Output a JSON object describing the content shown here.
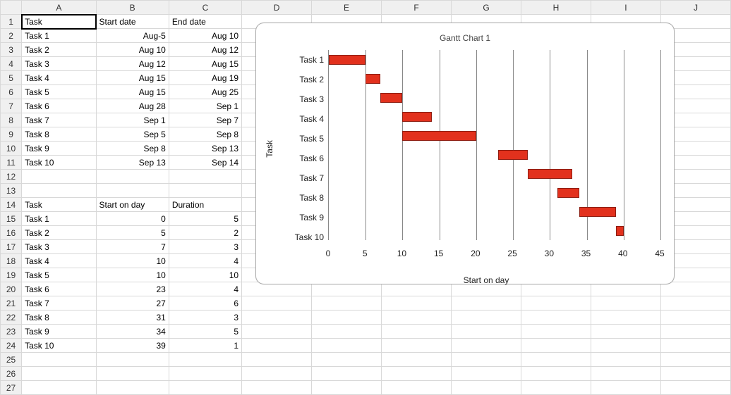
{
  "columns": [
    "A",
    "B",
    "C",
    "D",
    "E",
    "F",
    "G",
    "H",
    "I",
    "J"
  ],
  "row_count": 27,
  "selected_cell": "A1",
  "table1": {
    "row": 1,
    "headers": {
      "A": "Task",
      "B": "Start date",
      "C": "End date"
    },
    "rows": [
      {
        "A": "Task 1",
        "B": "Aug-5",
        "C": "Aug 10"
      },
      {
        "A": "Task 2",
        "B": "Aug 10",
        "C": "Aug 12"
      },
      {
        "A": "Task 3",
        "B": "Aug 12",
        "C": "Aug 15"
      },
      {
        "A": "Task 4",
        "B": "Aug 15",
        "C": "Aug 19"
      },
      {
        "A": "Task 5",
        "B": "Aug 15",
        "C": "Aug 25"
      },
      {
        "A": "Task 6",
        "B": "Aug 28",
        "C": "Sep 1"
      },
      {
        "A": "Task 7",
        "B": "Sep 1",
        "C": "Sep 7"
      },
      {
        "A": "Task 8",
        "B": "Sep 5",
        "C": "Sep 8"
      },
      {
        "A": "Task 9",
        "B": "Sep 8",
        "C": "Sep 13"
      },
      {
        "A": "Task 10",
        "B": "Sep 13",
        "C": "Sep 14"
      }
    ]
  },
  "table2": {
    "row": 14,
    "headers": {
      "A": "Task",
      "B": "Start on day",
      "C": "Duration"
    },
    "rows": [
      {
        "A": "Task 1",
        "B": "0",
        "C": "5"
      },
      {
        "A": "Task 2",
        "B": "5",
        "C": "2"
      },
      {
        "A": "Task 3",
        "B": "7",
        "C": "3"
      },
      {
        "A": "Task 4",
        "B": "10",
        "C": "4"
      },
      {
        "A": "Task 5",
        "B": "10",
        "C": "10"
      },
      {
        "A": "Task 6",
        "B": "23",
        "C": "4"
      },
      {
        "A": "Task 7",
        "B": "27",
        "C": "6"
      },
      {
        "A": "Task 8",
        "B": "31",
        "C": "3"
      },
      {
        "A": "Task 9",
        "B": "34",
        "C": "5"
      },
      {
        "A": "Task 10",
        "B": "39",
        "C": "1"
      }
    ]
  },
  "chart_data": {
    "type": "bar",
    "orientation": "horizontal",
    "title": "Gantt Chart 1",
    "xlabel": "Start on day",
    "ylabel": "Task",
    "xlim": [
      0,
      45
    ],
    "xticks": [
      0,
      5,
      10,
      15,
      20,
      25,
      30,
      35,
      40,
      45
    ],
    "categories": [
      "Task 1",
      "Task 2",
      "Task 3",
      "Task 4",
      "Task 5",
      "Task 6",
      "Task 7",
      "Task 8",
      "Task 9",
      "Task 10"
    ],
    "series": [
      {
        "name": "Start on day",
        "values": [
          0,
          5,
          7,
          10,
          10,
          23,
          27,
          31,
          34,
          39
        ],
        "visible": false
      },
      {
        "name": "Duration",
        "values": [
          5,
          2,
          3,
          4,
          10,
          4,
          6,
          3,
          5,
          1
        ],
        "visible": true,
        "color": "#e2311d"
      }
    ]
  }
}
